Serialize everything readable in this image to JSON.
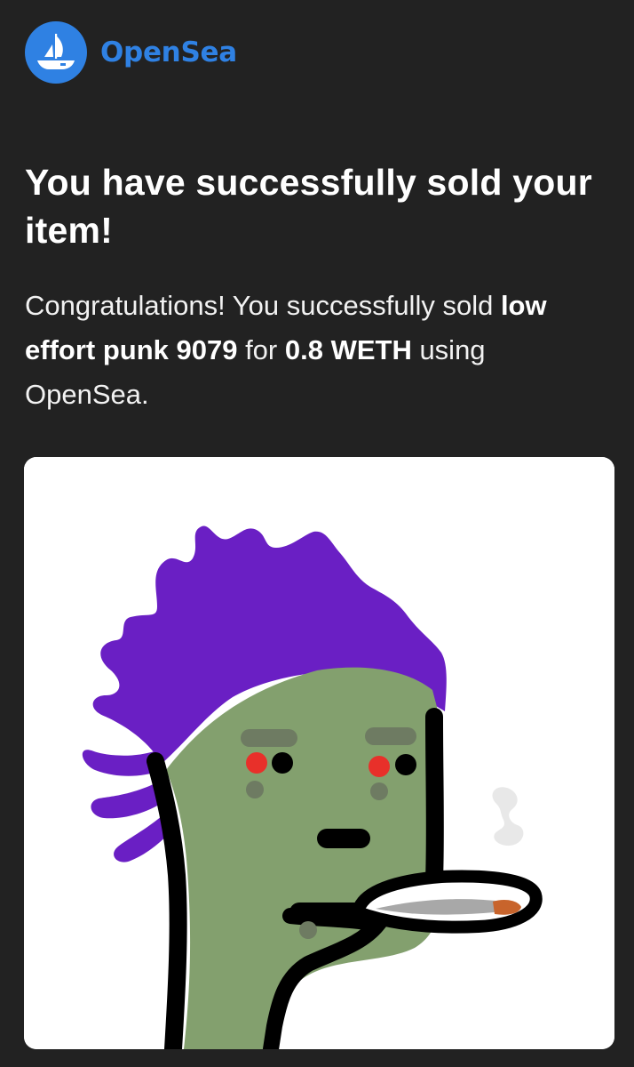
{
  "header": {
    "brand_name": "OpenSea",
    "logo_icon": "opensea-ship-logo-icon"
  },
  "headline": "You have successfully sold your item!",
  "message": {
    "intro": "Congratulations! You successfully sold ",
    "item_name": "low effort punk 9079",
    "for_text": " for ",
    "price": "0.8 WETH",
    "outro": " using OpenSea."
  },
  "nft_image": {
    "description_icon": "nft-punk-artwork-image"
  },
  "colors": {
    "background": "#222222",
    "brand_blue": "#2F81E3",
    "punk_skin": "#83A06E",
    "punk_hair": "#6A1FC4",
    "eye_red": "#E8302A"
  }
}
